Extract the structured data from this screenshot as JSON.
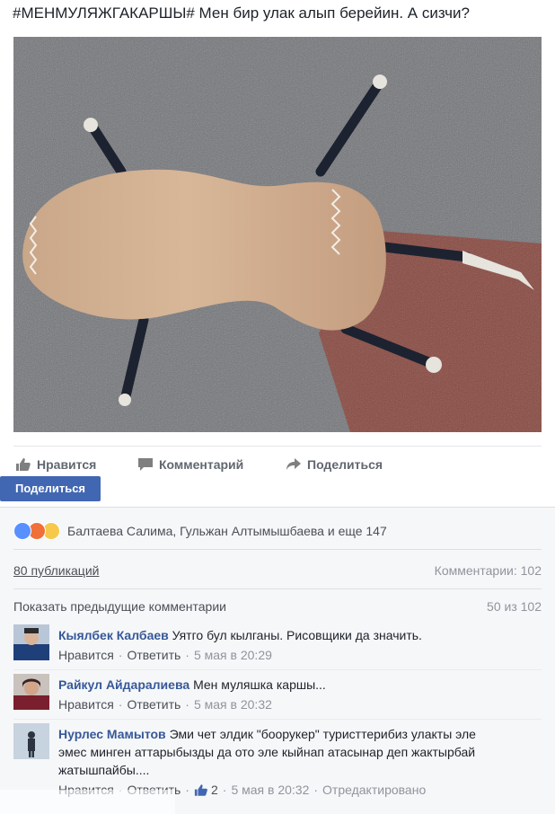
{
  "post": {
    "text": "#МЕНМУЛЯЖГАКАРШЫ# Мен бир улак алып берейин. А сизчи?"
  },
  "actions": {
    "like_label": "Нравится",
    "comment_label": "Комментарий",
    "share_label": "Поделиться"
  },
  "share_button_label": "Поделиться",
  "reactions": {
    "icons": [
      "like-icon",
      "angry-icon",
      "wow-icon"
    ],
    "summary": "Балтаева Салима, Гульжан Алтымышбаева и еще 147"
  },
  "stats": {
    "shares": "80 публикаций",
    "comments": "Комментарии: 102"
  },
  "previous": {
    "link": "Показать предыдущие комментарии",
    "counter": "50 из 102"
  },
  "comments": [
    {
      "author": "Кыялбек Калбаев",
      "text": "Уятго бул кылганы. Рисовщики да значить.",
      "like": "Нравится",
      "reply": "Ответить",
      "time": "5 мая в 20:29"
    },
    {
      "author": "Райкул Айдаралиева",
      "text": "Мен муляшка каршы...",
      "like": "Нравится",
      "reply": "Ответить",
      "time": "5 мая в 20:32"
    },
    {
      "author": "Нурлес Мамытов",
      "text": "Эми чет элдик \"боорукер\" туристтерибиз улакты эле эмес минген аттарыбызды да ото эле кыйнап атасынар деп жактырбай жатышпайбы....",
      "like": "Нравится",
      "reply": "Ответить",
      "likes_count": "2",
      "time": "5 мая в 20:32",
      "edited": "Отредактировано"
    }
  ],
  "colors": {
    "accent": "#4267b2",
    "link": "#365899",
    "panel": "#f6f7f9"
  }
}
